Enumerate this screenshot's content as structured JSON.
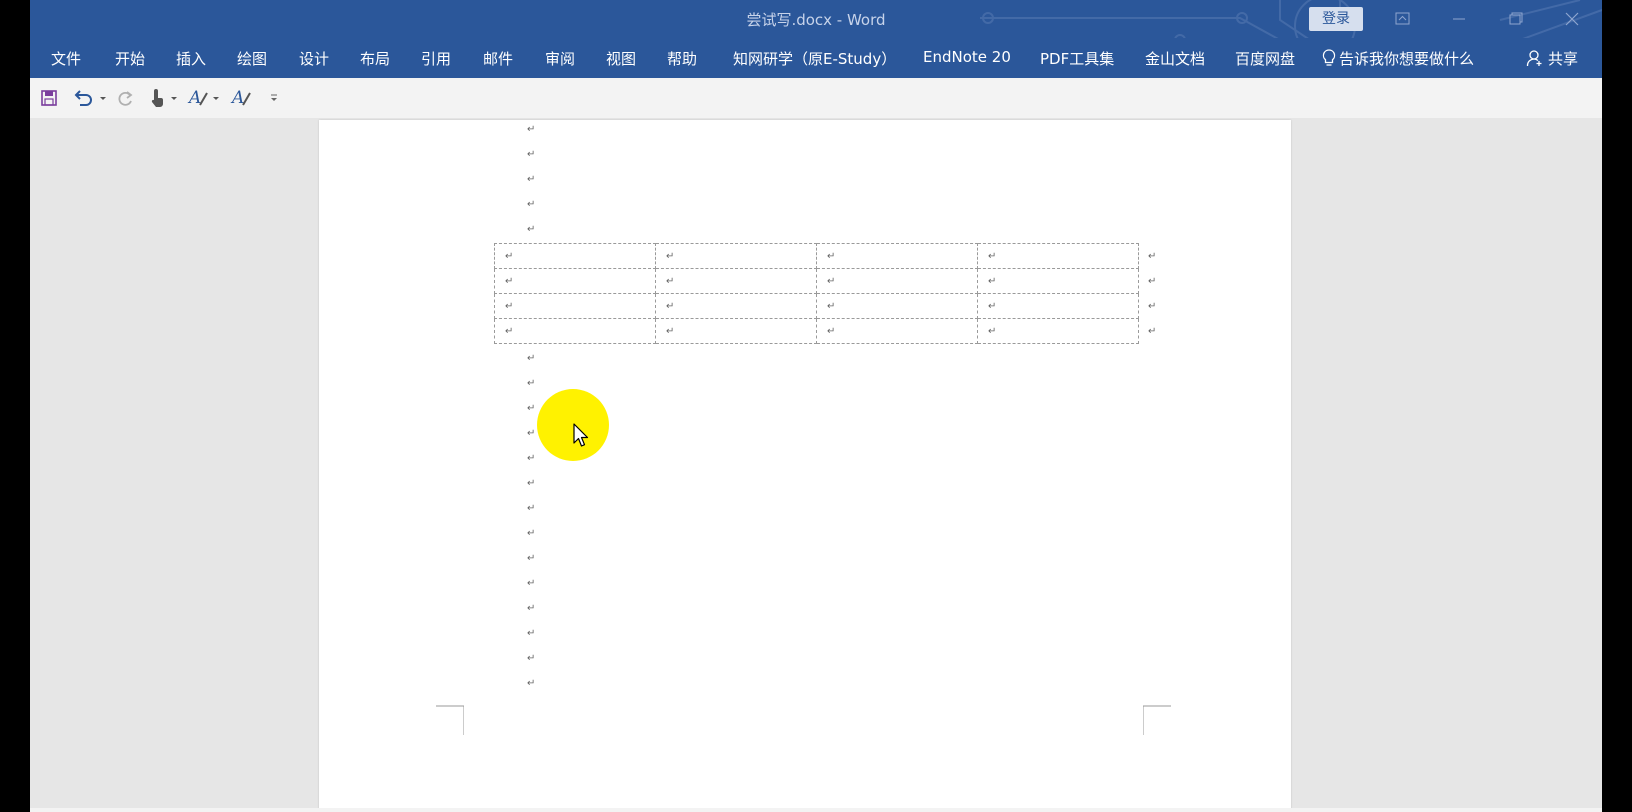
{
  "window": {
    "title": "尝试写.docx  -  Word",
    "login_label": "登录",
    "accent_color": "#2b579a"
  },
  "ribbon": {
    "tabs": [
      {
        "label": "文件"
      },
      {
        "label": "开始"
      },
      {
        "label": "插入"
      },
      {
        "label": "绘图"
      },
      {
        "label": "设计"
      },
      {
        "label": "布局"
      },
      {
        "label": "引用"
      },
      {
        "label": "邮件"
      },
      {
        "label": "审阅"
      },
      {
        "label": "视图"
      },
      {
        "label": "帮助"
      },
      {
        "label": "知网研学（原E-Study）"
      },
      {
        "label": "EndNote 20"
      },
      {
        "label": "PDF工具集"
      },
      {
        "label": "金山文档"
      },
      {
        "label": "百度网盘"
      }
    ],
    "tell_me": "告诉我你想要做什么",
    "share": "共享"
  },
  "quick_access": {
    "icons": [
      "save-icon",
      "undo-icon",
      "redo-icon",
      "touch-mode-icon",
      "format-painter-icon",
      "text-style-icon",
      "customize-dropdown-icon"
    ]
  },
  "document": {
    "paragraph_mark": "↵",
    "table": {
      "rows": [
        [
          "↵",
          "↵",
          "↵",
          "↵"
        ],
        [
          "↵",
          "↵",
          "↵",
          "↵"
        ],
        [
          "↵",
          "↵",
          "↵",
          "↵"
        ],
        [
          "↵",
          "↵",
          "↵",
          "↵"
        ]
      ]
    }
  }
}
